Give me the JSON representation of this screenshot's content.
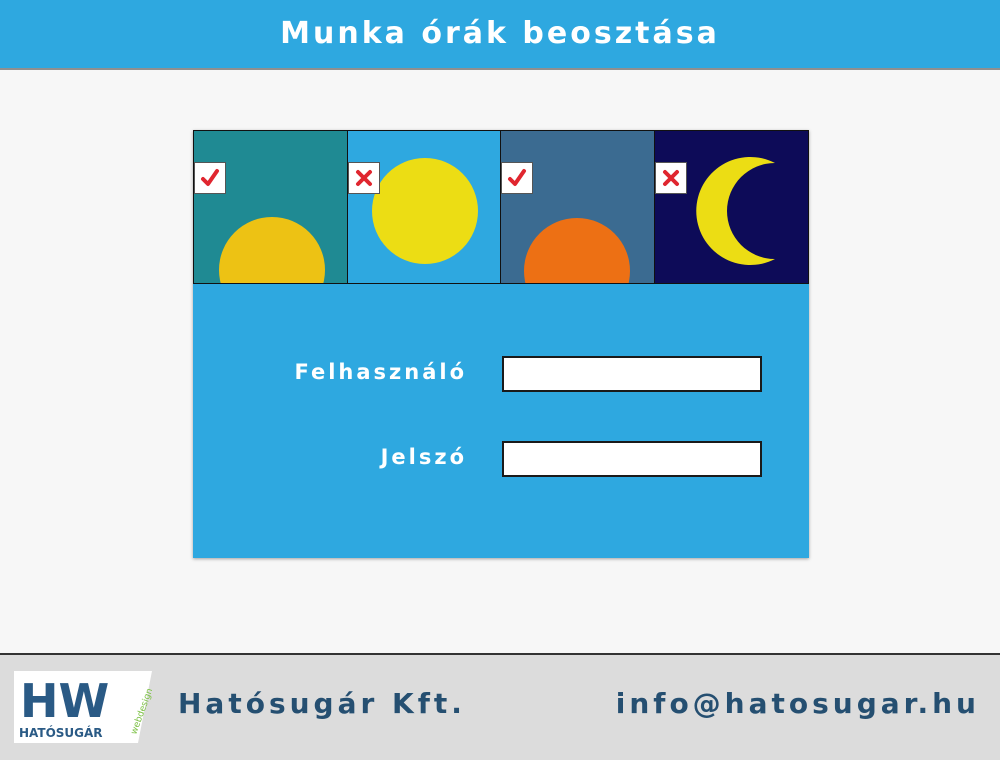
{
  "header": {
    "title": "Munka órák beosztása"
  },
  "tiles": [
    {
      "name": "sunrise",
      "icon": "sunrise-icon",
      "bg": "#1f8a93",
      "color": "#edc214",
      "selected": true
    },
    {
      "name": "day",
      "icon": "sun-icon",
      "bg": "#2ea8e0",
      "color": "#ecdd14",
      "selected": false
    },
    {
      "name": "sunset",
      "icon": "sunset-icon",
      "bg": "#3b6b91",
      "color": "#ed7014",
      "selected": true
    },
    {
      "name": "night",
      "icon": "moon-icon",
      "bg": "#0d0b58",
      "color": "#ecdd14",
      "selected": false
    }
  ],
  "status_icons": {
    "checked": "checkmark-icon",
    "unchecked": "cross-icon",
    "color": "#e0262f"
  },
  "form": {
    "username_label": "Felhasználó",
    "username_value": "",
    "password_label": "Jelszó",
    "password_value": ""
  },
  "footer": {
    "logo": {
      "letters": "HW",
      "name": "HATÓSUGÁR",
      "tag": "webdesign"
    },
    "company": "Hatósugár Kft.",
    "email": "info@hatosugar.hu"
  },
  "colors": {
    "accent": "#2ea8e0",
    "footer_text": "#254f71",
    "logo_text": "#2a5a85",
    "logo_accent": "#7bc043"
  }
}
